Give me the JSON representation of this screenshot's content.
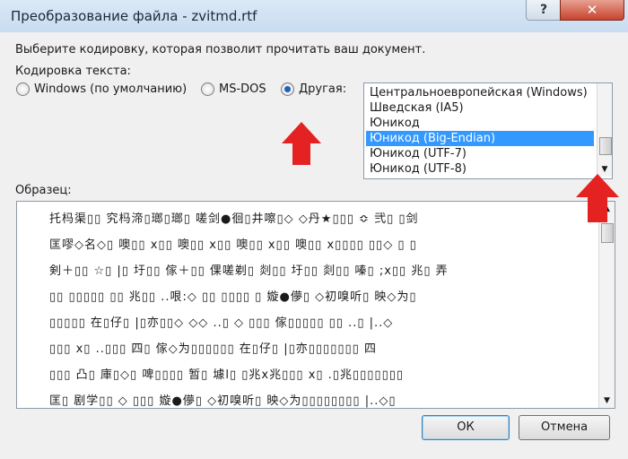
{
  "window": {
    "title": "Преобразование файла - zvitmd.rtf",
    "help_glyph": "?",
    "close_glyph": "✕"
  },
  "prompt": "Выберите кодировку, которая позволит прочитать ваш документ.",
  "encoding_label": "Кодировка текста:",
  "radios": [
    {
      "label": "Windows (по умолчанию)",
      "selected": false
    },
    {
      "label": "MS-DOS",
      "selected": false
    },
    {
      "label": "Другая:",
      "selected": true
    }
  ],
  "encodings": {
    "items": [
      "Центральноевропейская (Windows)",
      "Шведская (IA5)",
      "Юникод",
      "Юникод (Big-Endian)",
      "Юникод (UTF-7)",
      "Юникод (UTF-8)"
    ],
    "selected_index": 3
  },
  "sample_label": "Образец:",
  "sample_lines": [
    "托杩渠▯▯ 究杩渧▯瑯▯瑯▯ 嗟剑●徊▯井嚓▯◇ ◇丹★▯▯▯ ≎ 弐▯ ▯剑",
    "匡嘐◇名◇▯ 噢▯▯ x▯▯ 噢▯▯ x▯▯ 噢▯▯ x▯▯ 噢▯▯ x▯▯▯▯ ▯▯◇ ▯ ▯",
    "剣＋▯▯ ☆▯ |▯ 圩▯▯ 傢＋▯▯ 倮嗟剃▯ 剡▯▯ 圩▯▯ 剡▯▯ 嗪▯ ;x▯▯ 兆▯ 弄",
    "▯▯ ▯▯▯▯▯ ▯▯ 兆▯▯ ..哏:◇ ▯▯ ▯▯▯▯ ▯ 嫙●儚▯ ◇初嗅听▯ 映◇为▯",
    "▯▯▯▯▯ 在▯仔▯ |▯亦▯▯◇ ◇◇ ..▯ ◇ ▯▯▯ 傢▯▯▯▯▯ ▯▯ ..▯ |..◇",
    "▯▯▯ x▯ ..▯▯▯ 四▯ 傢◇为▯▯▯▯▯▯ 在▯仔▯ |▯亦▯▯▯▯▯▯▯ 四",
    "▯▯▯ 凸▯ 庫▯◇▯ 啤▯▯▯▯ 暂▯ 壉l▯ ▯兆x兆▯▯▯ x▯ .▯兆▯▯▯▯▯▯▯",
    "匡▯ 剧学▯▯ ◇ ▯▯▯ 嫙●儚▯ ◇初嗅听▯ 映◇为▯▯▯▯▯▯▯▯ |..◇▯"
  ],
  "buttons": {
    "ok": "ОК",
    "cancel": "Отмена"
  },
  "colors": {
    "annotation_arrow": "#e52222",
    "selection": "#3399ff"
  }
}
